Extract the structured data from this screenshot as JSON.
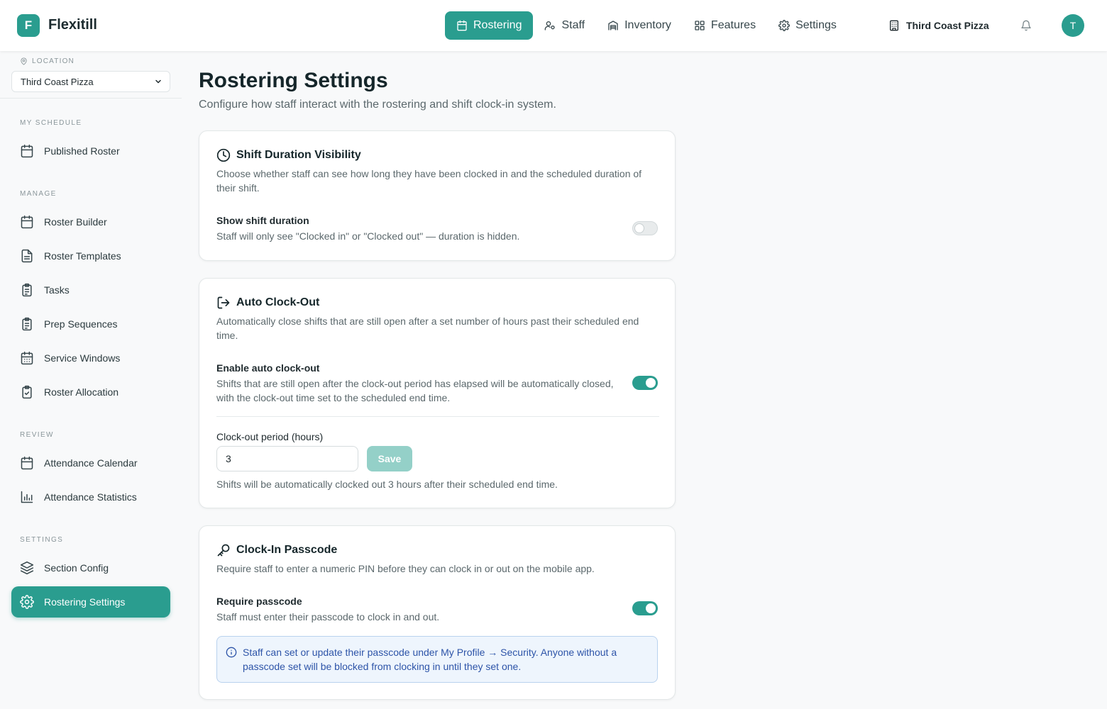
{
  "app": {
    "logo_letter": "F",
    "name": "Flexitill"
  },
  "nav": {
    "items": [
      {
        "label": "Rostering",
        "icon": "calendar-icon",
        "active": true
      },
      {
        "label": "Staff",
        "icon": "users-icon"
      },
      {
        "label": "Inventory",
        "icon": "warehouse-icon"
      },
      {
        "label": "Features",
        "icon": "grid-icon"
      },
      {
        "label": "Settings",
        "icon": "gear-icon"
      }
    ],
    "org_name": "Third Coast Pizza",
    "avatar_initial": "T"
  },
  "sidebar": {
    "location_label": "LOCATION",
    "location_value": "Third Coast Pizza",
    "sections": {
      "my_schedule": "MY SCHEDULE",
      "manage": "MANAGE",
      "review": "REVIEW",
      "settings": "SETTINGS"
    },
    "items": {
      "published_roster": "Published Roster",
      "roster_builder": "Roster Builder",
      "roster_templates": "Roster Templates",
      "tasks": "Tasks",
      "prep_sequences": "Prep Sequences",
      "service_windows": "Service Windows",
      "roster_allocation": "Roster Allocation",
      "attendance_calendar": "Attendance Calendar",
      "attendance_statistics": "Attendance Statistics",
      "section_config": "Section Config",
      "rostering_settings": "Rostering Settings"
    }
  },
  "page": {
    "title": "Rostering Settings",
    "subtitle": "Configure how staff interact with the rostering and shift clock-in system."
  },
  "shift_duration": {
    "title": "Shift Duration Visibility",
    "description": "Choose whether staff can see how long they have been clocked in and the scheduled duration of their shift.",
    "option_label": "Show shift duration",
    "option_help": "Staff will only see \"Clocked in\" or \"Clocked out\" — duration is hidden.",
    "enabled": false
  },
  "auto_clock_out": {
    "title": "Auto Clock-Out",
    "description": "Automatically close shifts that are still open after a set number of hours past their scheduled end time.",
    "option_label": "Enable auto clock-out",
    "option_help": "Shifts that are still open after the clock-out period has elapsed will be automatically closed, with the clock-out time set to the scheduled end time.",
    "enabled": true,
    "period_label": "Clock-out period (hours)",
    "period_value": "3",
    "save_label": "Save",
    "period_help": "Shifts will be automatically clocked out 3 hours after their scheduled end time."
  },
  "passcode": {
    "title": "Clock-In Passcode",
    "description": "Require staff to enter a numeric PIN before they can clock in or out on the mobile app.",
    "option_label": "Require passcode",
    "option_help": "Staff must enter their passcode to clock in and out.",
    "enabled": true,
    "info": "Staff can set or update their passcode under My Profile → Security. Anyone without a passcode set will be blocked from clocking in until they set one."
  },
  "colors": {
    "accent": "#2a9d8f",
    "info_text": "#2d54a8",
    "info_bg": "#eef5fd"
  }
}
